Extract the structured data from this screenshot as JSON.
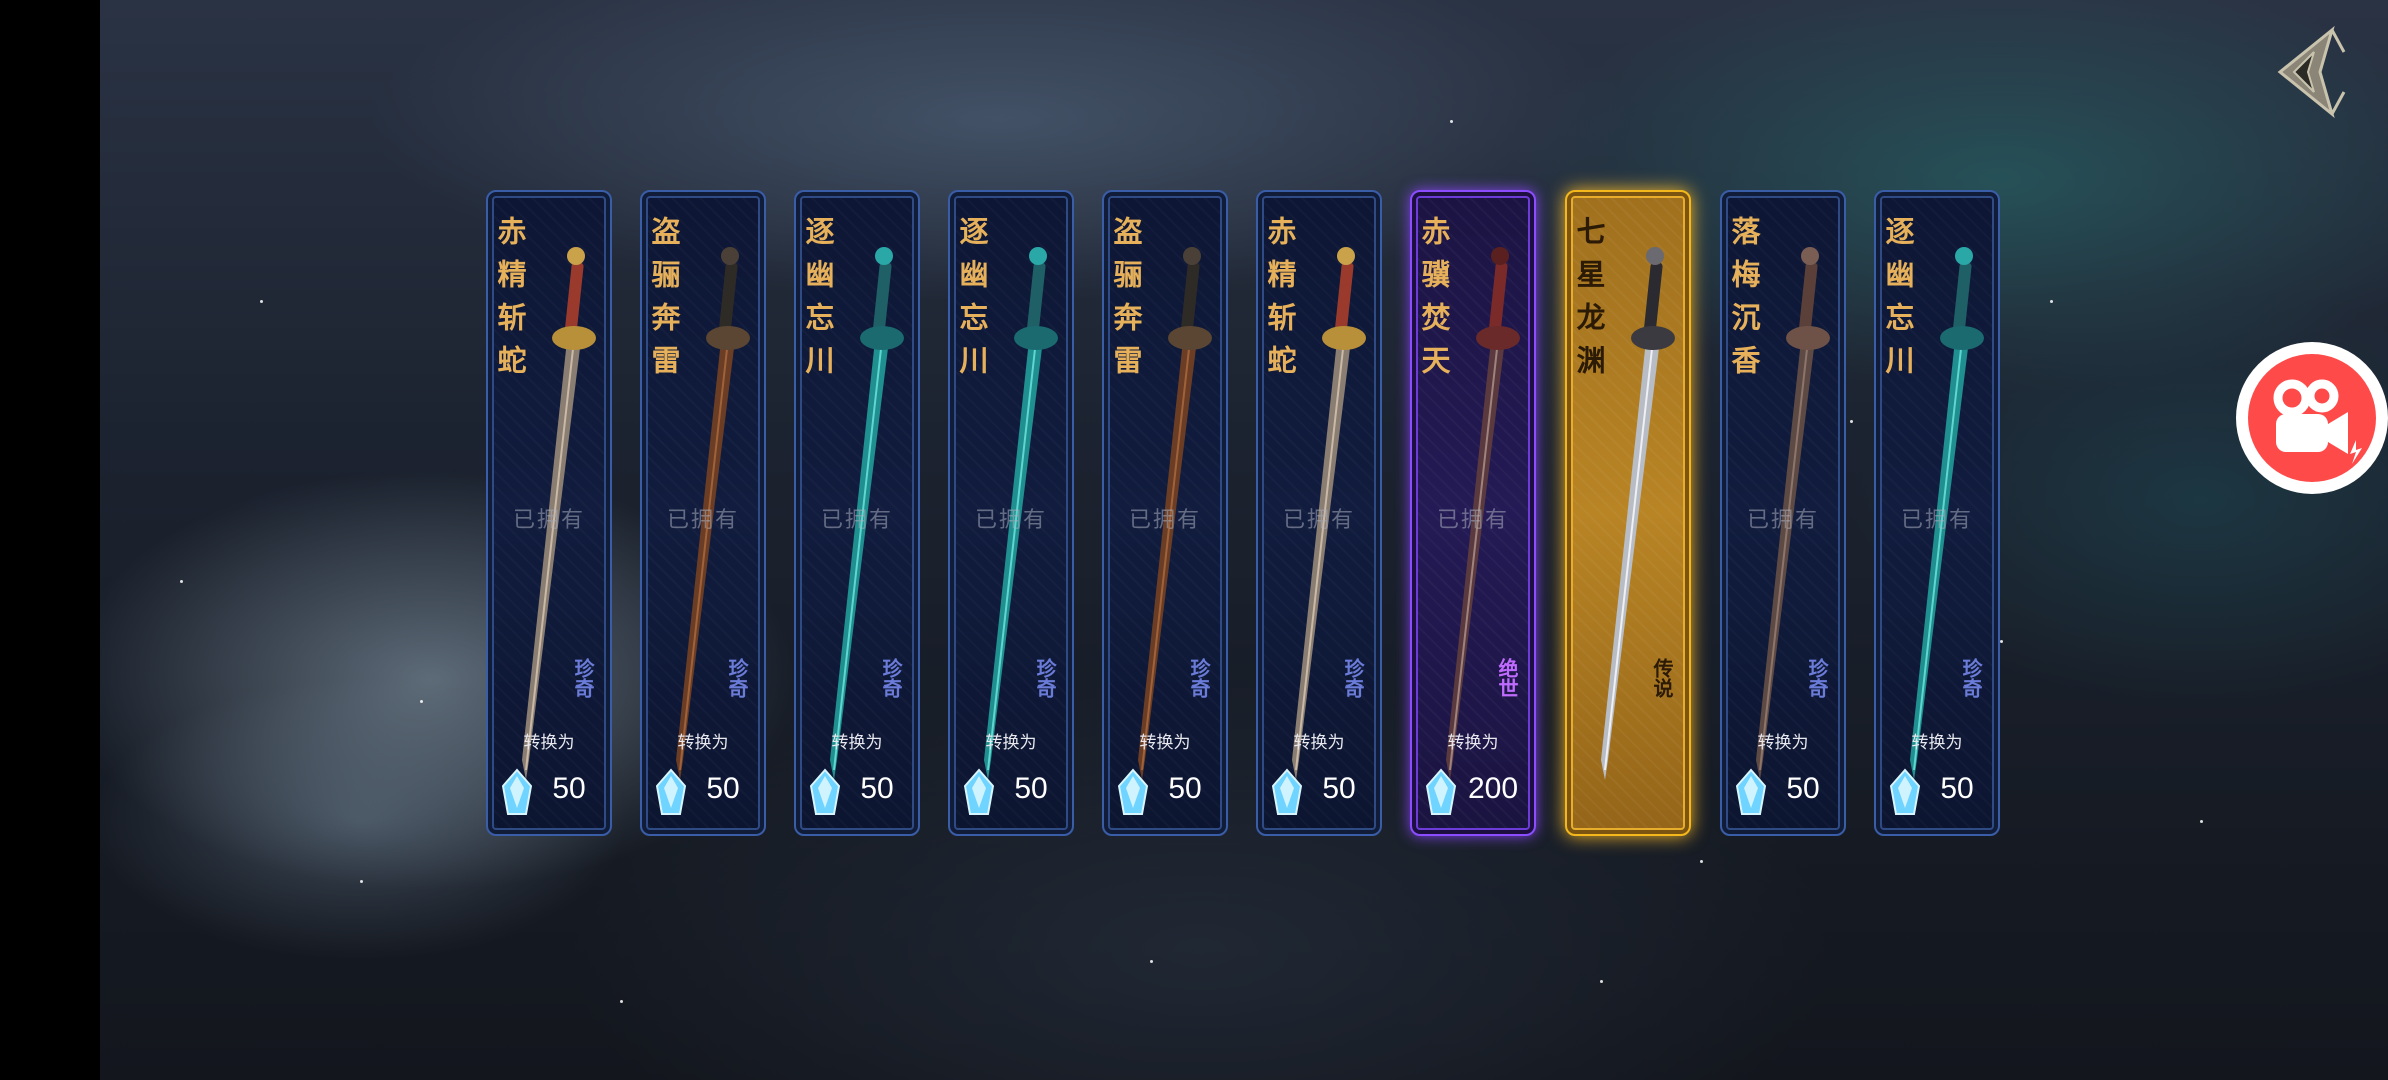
{
  "cards": [
    {
      "name": "赤精斩蛇",
      "owned_label": "已拥有",
      "rarity": "珍奇",
      "convert_label": "转换为",
      "amount": "50",
      "style": "blue",
      "sword": "red-hilt"
    },
    {
      "name": "盗骊奔雷",
      "owned_label": "已拥有",
      "rarity": "珍奇",
      "convert_label": "转换为",
      "amount": "50",
      "style": "blue",
      "sword": "bronze"
    },
    {
      "name": "逐幽忘川",
      "owned_label": "已拥有",
      "rarity": "珍奇",
      "convert_label": "转换为",
      "amount": "50",
      "style": "blue",
      "sword": "teal"
    },
    {
      "name": "逐幽忘川",
      "owned_label": "已拥有",
      "rarity": "珍奇",
      "convert_label": "转换为",
      "amount": "50",
      "style": "blue",
      "sword": "teal"
    },
    {
      "name": "盗骊奔雷",
      "owned_label": "已拥有",
      "rarity": "珍奇",
      "convert_label": "转换为",
      "amount": "50",
      "style": "blue",
      "sword": "bronze"
    },
    {
      "name": "赤精斩蛇",
      "owned_label": "已拥有",
      "rarity": "珍奇",
      "convert_label": "转换为",
      "amount": "50",
      "style": "blue",
      "sword": "red-hilt"
    },
    {
      "name": "赤骥焚天",
      "owned_label": "已拥有",
      "rarity": "绝世",
      "convert_label": "转换为",
      "amount": "200",
      "style": "purple",
      "sword": "dark-red"
    },
    {
      "name": "七星龙渊",
      "owned_label": "",
      "rarity": "传说",
      "convert_label": "",
      "amount": "",
      "style": "gold",
      "sword": "silver"
    },
    {
      "name": "落梅沉香",
      "owned_label": "已拥有",
      "rarity": "珍奇",
      "convert_label": "转换为",
      "amount": "50",
      "style": "blue",
      "sword": "brown"
    },
    {
      "name": "逐幽忘川",
      "owned_label": "已拥有",
      "rarity": "珍奇",
      "convert_label": "转换为",
      "amount": "50",
      "style": "blue",
      "sword": "teal"
    }
  ],
  "icons": {
    "back": "back-arrow-icon",
    "record": "video-camera-icon",
    "currency": "crystal-icon"
  },
  "colors": {
    "blue_frame": "#3a5da8",
    "purple_frame": "#8b4dff",
    "gold_frame": "#f4b81c",
    "name_text": "#e6b15a",
    "record_button": "#ff4a4a"
  }
}
